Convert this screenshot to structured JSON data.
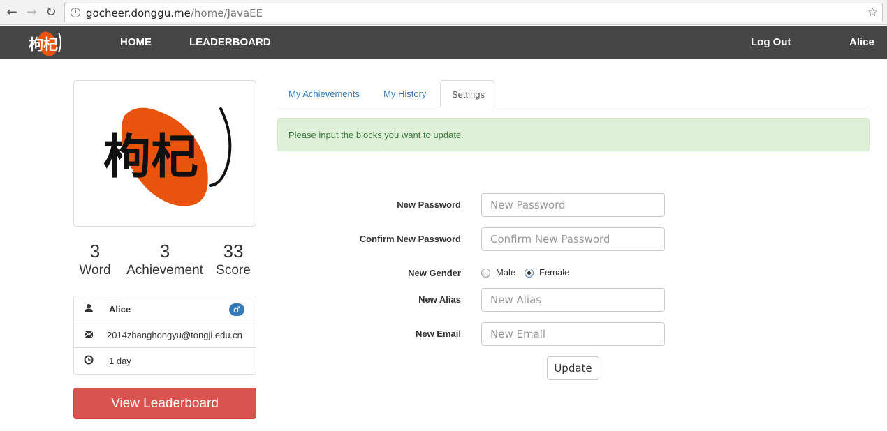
{
  "browser": {
    "url_host": "gocheer.donggu.me",
    "url_path": "/home/JavaEE"
  },
  "navbar": {
    "logo_text": "枸杞",
    "home": "HOME",
    "leaderboard": "LEADERBOARD",
    "logout": "Log Out",
    "user": "Alice"
  },
  "profile": {
    "logo_text": "枸杞",
    "stats": [
      {
        "value": "3",
        "label": "Word"
      },
      {
        "value": "3",
        "label": "Achievement"
      },
      {
        "value": "33",
        "label": "Score"
      }
    ],
    "name": "Alice",
    "gender_symbol": "♂",
    "email": "2014zhanghongyu@tongji.edu.cn",
    "duration": "1 day",
    "leaderboard_button": "View Leaderboard"
  },
  "tabs": [
    {
      "label": "My Achievements"
    },
    {
      "label": "My History"
    },
    {
      "label": "Settings"
    }
  ],
  "alert": "Please input the blocks you want to update.",
  "form": {
    "new_password_label": "New Password",
    "new_password_placeholder": "New Password",
    "confirm_password_label": "Confirm New Password",
    "confirm_password_placeholder": "Confirm New Password",
    "gender_label": "New Gender",
    "gender_male": "Male",
    "gender_female": "Female",
    "gender_selected": "Female",
    "alias_label": "New Alias",
    "alias_placeholder": "New Alias",
    "email_label": "New Email",
    "email_placeholder": "New Email",
    "update_button": "Update"
  },
  "colors": {
    "navbar_bg": "#454545",
    "logo_orange": "#e8540d",
    "danger": "#d9534f",
    "link": "#337ab7",
    "alert_bg": "#dff0d8"
  }
}
